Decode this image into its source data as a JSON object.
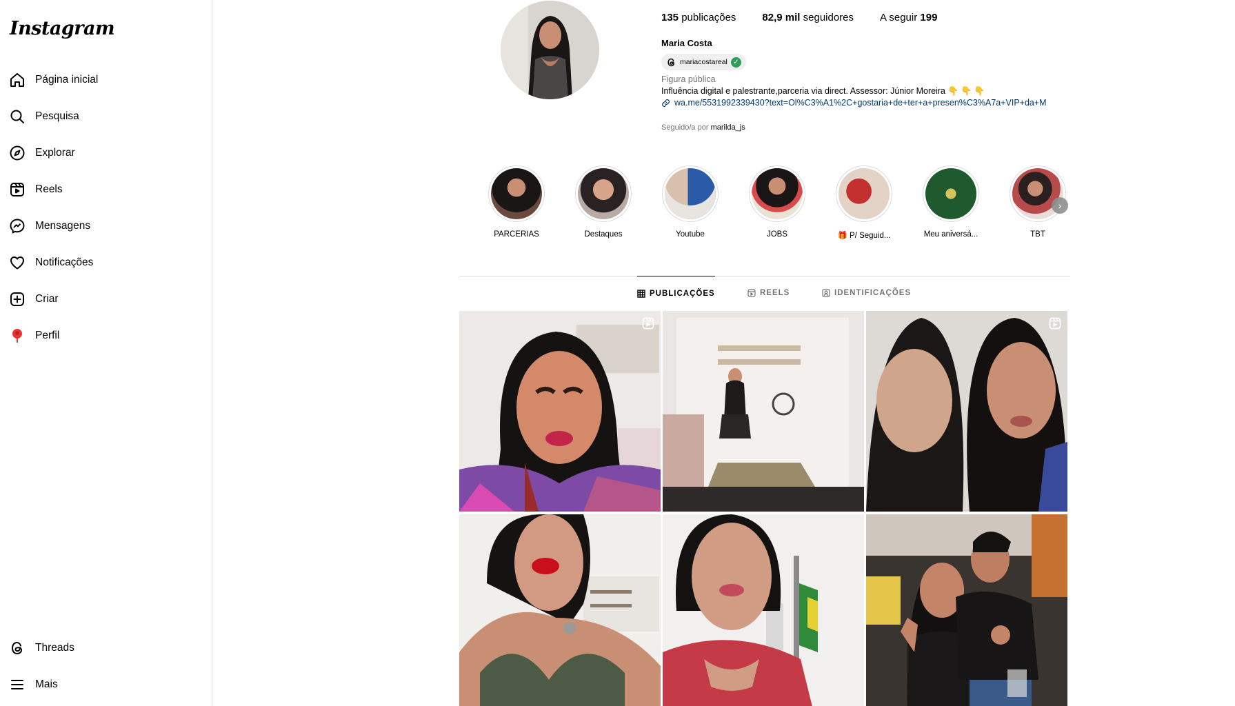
{
  "app": {
    "logo": "Instagram"
  },
  "sidebar": {
    "items": [
      {
        "label": "Página inicial",
        "icon": "home-icon"
      },
      {
        "label": "Pesquisa",
        "icon": "search-icon"
      },
      {
        "label": "Explorar",
        "icon": "compass-icon"
      },
      {
        "label": "Reels",
        "icon": "reels-icon"
      },
      {
        "label": "Mensagens",
        "icon": "messenger-icon"
      },
      {
        "label": "Notificações",
        "icon": "heart-icon"
      },
      {
        "label": "Criar",
        "icon": "plus-square-icon"
      },
      {
        "label": "Perfil",
        "icon": "profile-avatar-icon"
      }
    ],
    "bottom": [
      {
        "label": "Threads",
        "icon": "threads-icon"
      },
      {
        "label": "Mais",
        "icon": "menu-icon"
      }
    ]
  },
  "profile": {
    "posts_count": "135",
    "posts_label": "publicações",
    "followers_count": "82,9 mil",
    "followers_label": "seguidores",
    "following_label": "A seguir",
    "following_count": "199",
    "name": "Maria Costa",
    "threads_handle": "mariacostareal",
    "category": "Figura pública",
    "bio": "Influência digital e palestrante,parceria via direct. Assessor: Júnior Moreira 👇 👇 👇",
    "link": "wa.me/5531992339430?text=Ol%C3%A1%2C+gostaria+de+ter+a+presen%C3%A7a+VIP+da+M",
    "followed_by_prefix": "Seguido/a por",
    "followed_by_user": "marilda_js"
  },
  "highlights": [
    {
      "label": "PARCERIAS",
      "color": "#6b4a3e"
    },
    {
      "label": "Destaques",
      "color": "#8a6a62"
    },
    {
      "label": "Youtube",
      "color": "#c9c0b8"
    },
    {
      "label": "JOBS",
      "color": "#4a3a36"
    },
    {
      "label": "🎁 P/ Seguid...",
      "color": "#b0413a"
    },
    {
      "label": "Meu aniversá...",
      "color": "#1f5a2e"
    },
    {
      "label": "TBT",
      "color": "#8c4a40"
    }
  ],
  "tabs": [
    {
      "label": "PUBLICAÇÕES",
      "icon": "grid-icon"
    },
    {
      "label": "REELS",
      "icon": "reels-icon"
    },
    {
      "label": "IDENTIFICAÇÕES",
      "icon": "tagged-icon"
    }
  ],
  "posts": [
    {
      "kind": "reel"
    },
    {
      "kind": "photo"
    },
    {
      "kind": "reel"
    },
    {
      "kind": "photo"
    },
    {
      "kind": "photo"
    },
    {
      "kind": "photo"
    }
  ]
}
